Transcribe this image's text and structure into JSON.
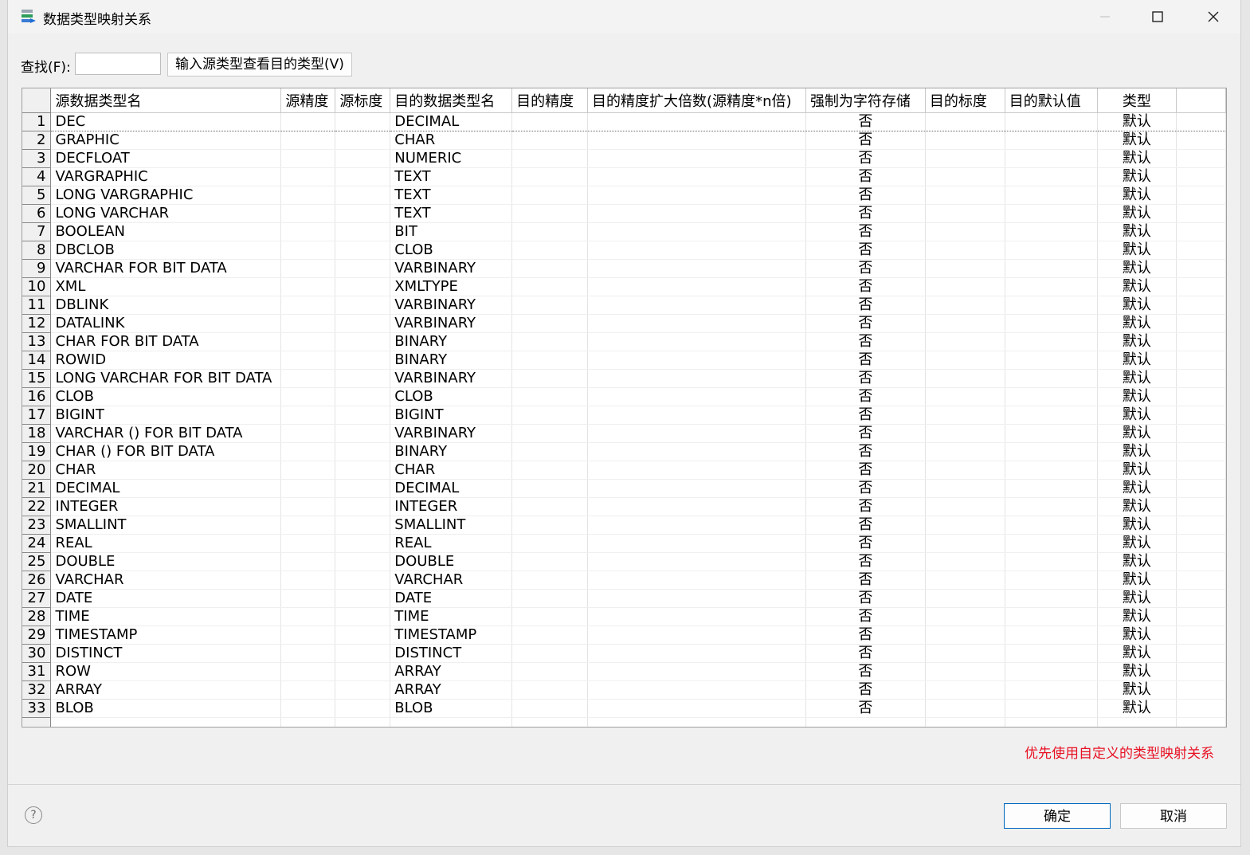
{
  "window": {
    "title": "数据类型映射关系",
    "controls": {
      "minimize": "—",
      "maximize": "☐",
      "close": "✕"
    }
  },
  "toolbar": {
    "find_label": "查找(F):",
    "find_value": "",
    "lookup_button": "输入源类型查看目的类型(V)"
  },
  "table": {
    "columns": [
      "源数据类型名",
      "源精度",
      "源标度",
      "目的数据类型名",
      "目的精度",
      "目的精度扩大倍数(源精度*n倍)",
      "强制为字符存储",
      "目的标度",
      "目的默认值",
      "类型"
    ],
    "rows": [
      [
        "1",
        "DEC",
        "",
        "",
        "DECIMAL",
        "",
        "",
        "否",
        "",
        "",
        "默认"
      ],
      [
        "2",
        "GRAPHIC",
        "",
        "",
        "CHAR",
        "",
        "",
        "否",
        "",
        "",
        "默认"
      ],
      [
        "3",
        "DECFLOAT",
        "",
        "",
        "NUMERIC",
        "",
        "",
        "否",
        "",
        "",
        "默认"
      ],
      [
        "4",
        "VARGRAPHIC",
        "",
        "",
        "TEXT",
        "",
        "",
        "否",
        "",
        "",
        "默认"
      ],
      [
        "5",
        "LONG VARGRAPHIC",
        "",
        "",
        "TEXT",
        "",
        "",
        "否",
        "",
        "",
        "默认"
      ],
      [
        "6",
        "LONG VARCHAR",
        "",
        "",
        "TEXT",
        "",
        "",
        "否",
        "",
        "",
        "默认"
      ],
      [
        "7",
        "BOOLEAN",
        "",
        "",
        "BIT",
        "",
        "",
        "否",
        "",
        "",
        "默认"
      ],
      [
        "8",
        "DBCLOB",
        "",
        "",
        "CLOB",
        "",
        "",
        "否",
        "",
        "",
        "默认"
      ],
      [
        "9",
        "VARCHAR FOR BIT DATA",
        "",
        "",
        "VARBINARY",
        "",
        "",
        "否",
        "",
        "",
        "默认"
      ],
      [
        "10",
        "XML",
        "",
        "",
        "XMLTYPE",
        "",
        "",
        "否",
        "",
        "",
        "默认"
      ],
      [
        "11",
        "DBLINK",
        "",
        "",
        "VARBINARY",
        "",
        "",
        "否",
        "",
        "",
        "默认"
      ],
      [
        "12",
        "DATALINK",
        "",
        "",
        "VARBINARY",
        "",
        "",
        "否",
        "",
        "",
        "默认"
      ],
      [
        "13",
        "CHAR FOR BIT DATA",
        "",
        "",
        "BINARY",
        "",
        "",
        "否",
        "",
        "",
        "默认"
      ],
      [
        "14",
        "ROWID",
        "",
        "",
        "BINARY",
        "",
        "",
        "否",
        "",
        "",
        "默认"
      ],
      [
        "15",
        "LONG VARCHAR FOR BIT DATA",
        "",
        "",
        "VARBINARY",
        "",
        "",
        "否",
        "",
        "",
        "默认"
      ],
      [
        "16",
        "CLOB",
        "",
        "",
        "CLOB",
        "",
        "",
        "否",
        "",
        "",
        "默认"
      ],
      [
        "17",
        "BIGINT",
        "",
        "",
        "BIGINT",
        "",
        "",
        "否",
        "",
        "",
        "默认"
      ],
      [
        "18",
        "VARCHAR () FOR BIT DATA",
        "",
        "",
        "VARBINARY",
        "",
        "",
        "否",
        "",
        "",
        "默认"
      ],
      [
        "19",
        "CHAR () FOR BIT DATA",
        "",
        "",
        "BINARY",
        "",
        "",
        "否",
        "",
        "",
        "默认"
      ],
      [
        "20",
        "CHAR",
        "",
        "",
        "CHAR",
        "",
        "",
        "否",
        "",
        "",
        "默认"
      ],
      [
        "21",
        "DECIMAL",
        "",
        "",
        "DECIMAL",
        "",
        "",
        "否",
        "",
        "",
        "默认"
      ],
      [
        "22",
        "INTEGER",
        "",
        "",
        "INTEGER",
        "",
        "",
        "否",
        "",
        "",
        "默认"
      ],
      [
        "23",
        "SMALLINT",
        "",
        "",
        "SMALLINT",
        "",
        "",
        "否",
        "",
        "",
        "默认"
      ],
      [
        "24",
        "REAL",
        "",
        "",
        "REAL",
        "",
        "",
        "否",
        "",
        "",
        "默认"
      ],
      [
        "25",
        "DOUBLE",
        "",
        "",
        "DOUBLE",
        "",
        "",
        "否",
        "",
        "",
        "默认"
      ],
      [
        "26",
        "VARCHAR",
        "",
        "",
        "VARCHAR",
        "",
        "",
        "否",
        "",
        "",
        "默认"
      ],
      [
        "27",
        "DATE",
        "",
        "",
        "DATE",
        "",
        "",
        "否",
        "",
        "",
        "默认"
      ],
      [
        "28",
        "TIME",
        "",
        "",
        "TIME",
        "",
        "",
        "否",
        "",
        "",
        "默认"
      ],
      [
        "29",
        "TIMESTAMP",
        "",
        "",
        "TIMESTAMP",
        "",
        "",
        "否",
        "",
        "",
        "默认"
      ],
      [
        "30",
        "DISTINCT",
        "",
        "",
        "DISTINCT",
        "",
        "",
        "否",
        "",
        "",
        "默认"
      ],
      [
        "31",
        "ROW",
        "",
        "",
        "ARRAY",
        "",
        "",
        "否",
        "",
        "",
        "默认"
      ],
      [
        "32",
        "ARRAY",
        "",
        "",
        "ARRAY",
        "",
        "",
        "否",
        "",
        "",
        "默认"
      ],
      [
        "33",
        "BLOB",
        "",
        "",
        "BLOB",
        "",
        "",
        "否",
        "",
        "",
        "默认"
      ]
    ]
  },
  "hint": "优先使用自定义的类型映射关系",
  "footer": {
    "help": "?",
    "ok": "确定",
    "cancel": "取消"
  },
  "colors": {
    "hint": "#e81123",
    "ok_border": "#0067c0"
  }
}
